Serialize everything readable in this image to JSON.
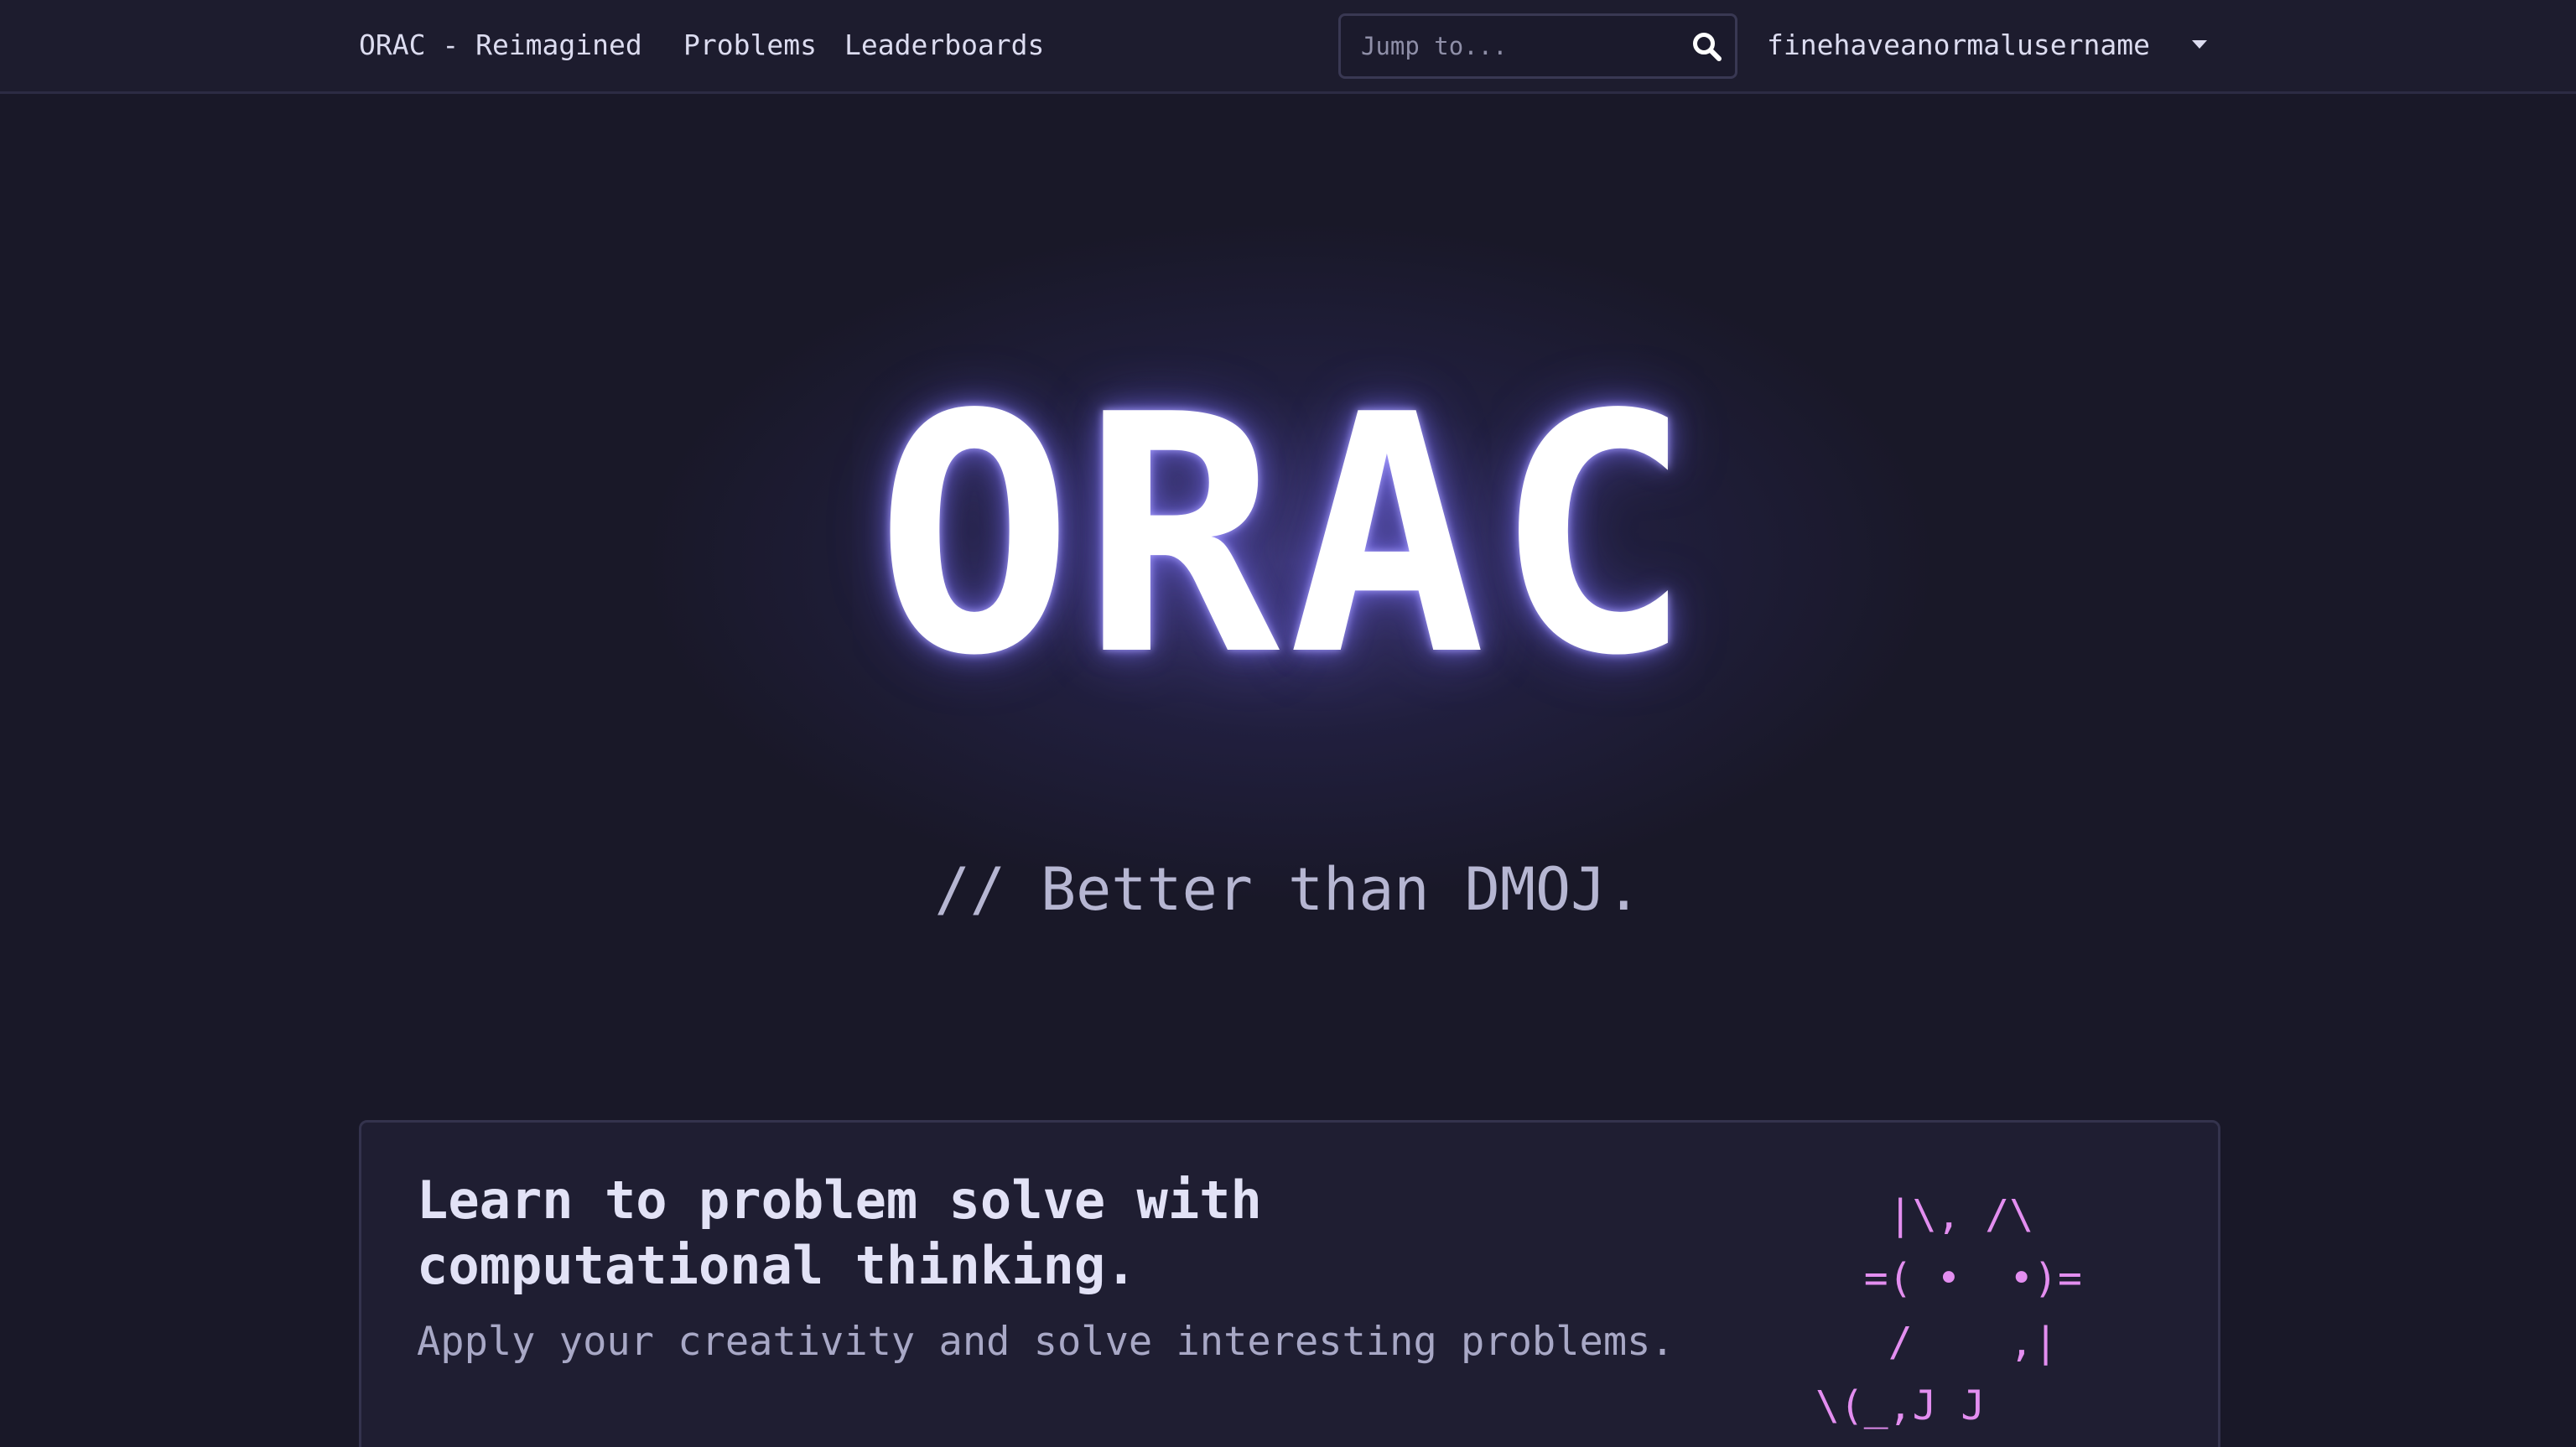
{
  "nav": {
    "brand": "ORAC - Reimagined",
    "links": [
      "Problems",
      "Leaderboards"
    ],
    "search_placeholder": "Jump to...",
    "username": "finehaveanormalusername"
  },
  "hero": {
    "title": "ORAC",
    "subtitle": "// Better than DMOJ."
  },
  "card": {
    "heading": "Learn to problem solve with computational thinking.",
    "text": "Apply your creativity and solve interesting problems.",
    "ascii_art": "   |\\, /\\\n  =( •  •)=\n   /    ,|\n\\(_,J J"
  },
  "colors": {
    "background": "#191828",
    "ascii_accent": "#e38ef0"
  }
}
